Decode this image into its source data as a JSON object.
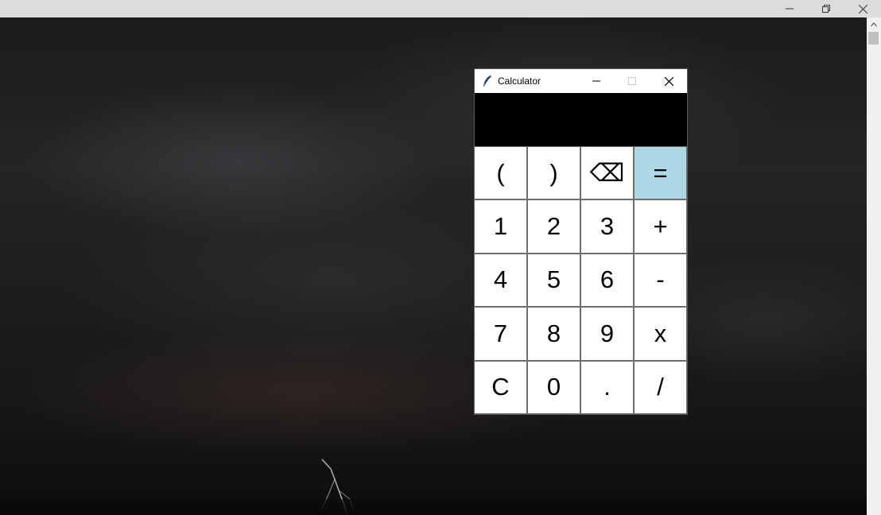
{
  "calculator": {
    "title": "Calculator",
    "display_value": "",
    "rows": [
      [
        {
          "label": "(",
          "name": "key-open-paren"
        },
        {
          "label": ")",
          "name": "key-close-paren"
        },
        {
          "label": "⌫",
          "name": "backspace-button"
        },
        {
          "label": "=",
          "name": "equals-button"
        }
      ],
      [
        {
          "label": "1",
          "name": "key-1"
        },
        {
          "label": "2",
          "name": "key-2"
        },
        {
          "label": "3",
          "name": "key-3"
        },
        {
          "label": "+",
          "name": "plus-button"
        }
      ],
      [
        {
          "label": "4",
          "name": "key-4"
        },
        {
          "label": "5",
          "name": "key-5"
        },
        {
          "label": "6",
          "name": "key-6"
        },
        {
          "label": "-",
          "name": "minus-button"
        }
      ],
      [
        {
          "label": "7",
          "name": "key-7"
        },
        {
          "label": "8",
          "name": "key-8"
        },
        {
          "label": "9",
          "name": "key-9"
        },
        {
          "label": "x",
          "name": "multiply-button"
        }
      ],
      [
        {
          "label": "C",
          "name": "clear-button"
        },
        {
          "label": "0",
          "name": "key-0"
        },
        {
          "label": ".",
          "name": "decimal-button"
        },
        {
          "label": "/",
          "name": "divide-button"
        }
      ]
    ]
  },
  "colors": {
    "equals_key": "#add8e6",
    "display_background": "#000000",
    "key_background": "#ffffff"
  },
  "icons": {
    "app": "feather-icon",
    "minimize": "minimize-icon",
    "maximize": "maximize-icon",
    "close": "close-icon",
    "restore": "restore-icon"
  }
}
